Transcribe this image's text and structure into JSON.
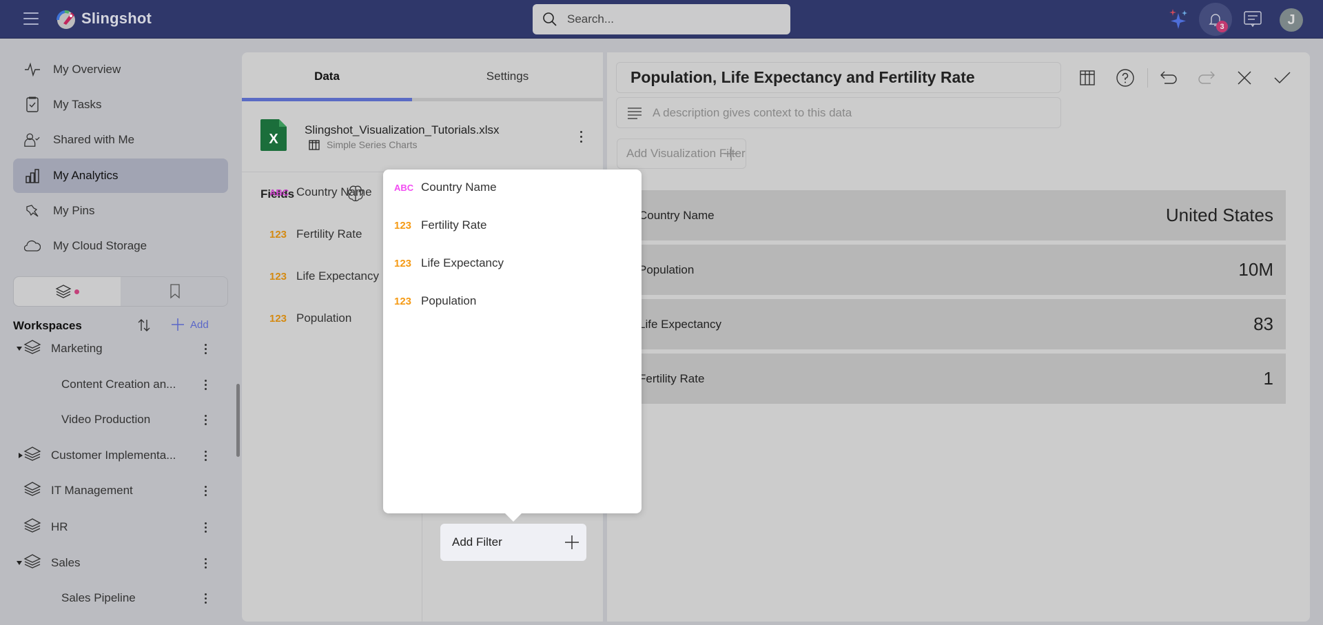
{
  "app": {
    "brand": "Slingshot",
    "search_placeholder": "Search...",
    "notifications_count": "3",
    "avatar_initial": "J"
  },
  "sidebar": {
    "nav": [
      {
        "label": "My Overview",
        "icon": "activity-icon"
      },
      {
        "label": "My Tasks",
        "icon": "clipboard-check-icon"
      },
      {
        "label": "Shared with Me",
        "icon": "user-check-icon"
      },
      {
        "label": "My Analytics",
        "icon": "bar-chart-icon",
        "active": true
      },
      {
        "label": "My Pins",
        "icon": "pin-icon"
      },
      {
        "label": "My Cloud Storage",
        "icon": "cloud-icon"
      }
    ],
    "workspaces_title": "Workspaces",
    "add_label": "Add",
    "workspaces": [
      {
        "label": "Marketing",
        "level": 0,
        "expanded": true
      },
      {
        "label": "Content Creation an...",
        "level": 1
      },
      {
        "label": "Video Production",
        "level": 1
      },
      {
        "label": "Customer Implementa...",
        "level": 0,
        "expanded": false
      },
      {
        "label": "IT Management",
        "level": 0
      },
      {
        "label": "HR",
        "level": 0
      },
      {
        "label": "Sales",
        "level": 0,
        "expanded": true
      },
      {
        "label": "Sales Pipeline",
        "level": 1
      }
    ]
  },
  "data_panel": {
    "tabs": [
      {
        "label": "Data",
        "active": true
      },
      {
        "label": "Settings"
      }
    ],
    "source": {
      "file": "Slingshot_Visualization_Tutorials.xlsx",
      "sheet": "Simple Series Charts"
    },
    "fields_title": "Fields",
    "fields": [
      {
        "type": "ABC",
        "label": "Country Name"
      },
      {
        "type": "123",
        "label": "Fertility Rate"
      },
      {
        "type": "123",
        "label": "Life Expectancy"
      },
      {
        "type": "123",
        "label": "Population"
      }
    ],
    "add_filter_label": "Add Filter"
  },
  "popover": {
    "items": [
      {
        "type": "ABC",
        "label": "Country Name"
      },
      {
        "type": "123",
        "label": "Fertility Rate"
      },
      {
        "type": "123",
        "label": "Life Expectancy"
      },
      {
        "type": "123",
        "label": "Population"
      }
    ]
  },
  "viz": {
    "title": "Population, Life Expectancy and Fertility Rate",
    "description_placeholder": "A description gives context to this data",
    "add_viz_filter_label": "Add Visualization Filter",
    "rows": [
      {
        "label": "Country Name",
        "value": "United States"
      },
      {
        "label": "Population",
        "value": "10M"
      },
      {
        "label": "Life Expectancy",
        "value": "83"
      },
      {
        "label": "Fertility Rate",
        "value": "1"
      }
    ]
  },
  "colors": {
    "topbar": "#2f376a",
    "accent": "#5a6bc4",
    "badge": "#c23a70",
    "type_text": "#c840c8",
    "type_number": "#d48a12"
  }
}
